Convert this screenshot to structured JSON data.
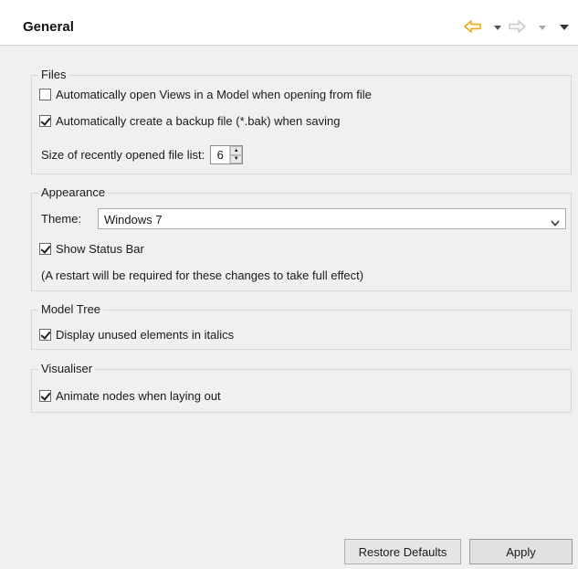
{
  "header": {
    "title": "General"
  },
  "files": {
    "legend": "Files",
    "open_views_label": "Automatically open Views in a Model when opening from file",
    "open_views_checked": false,
    "backup_label": "Automatically create a backup file (*.bak) when saving",
    "backup_checked": true,
    "recent_label": "Size of recently opened file list:",
    "recent_value": "6"
  },
  "appearance": {
    "legend": "Appearance",
    "theme_label": "Theme:",
    "theme_value": "Windows 7",
    "status_bar_label": "Show Status Bar",
    "status_bar_checked": true,
    "restart_note": "(A restart will be required for these changes to take full effect)"
  },
  "model_tree": {
    "legend": "Model Tree",
    "italics_label": "Display unused elements in italics",
    "italics_checked": true
  },
  "visualiser": {
    "legend": "Visualiser",
    "animate_label": "Animate nodes when laying out",
    "animate_checked": true
  },
  "buttons": {
    "restore_defaults": "Restore Defaults",
    "apply": "Apply"
  },
  "colors": {
    "back_arrow": "#e8a81c",
    "forward_arrow": "#c9c9c9",
    "header_bg": "#ffffff",
    "panel_bg": "#f0f0f0"
  }
}
